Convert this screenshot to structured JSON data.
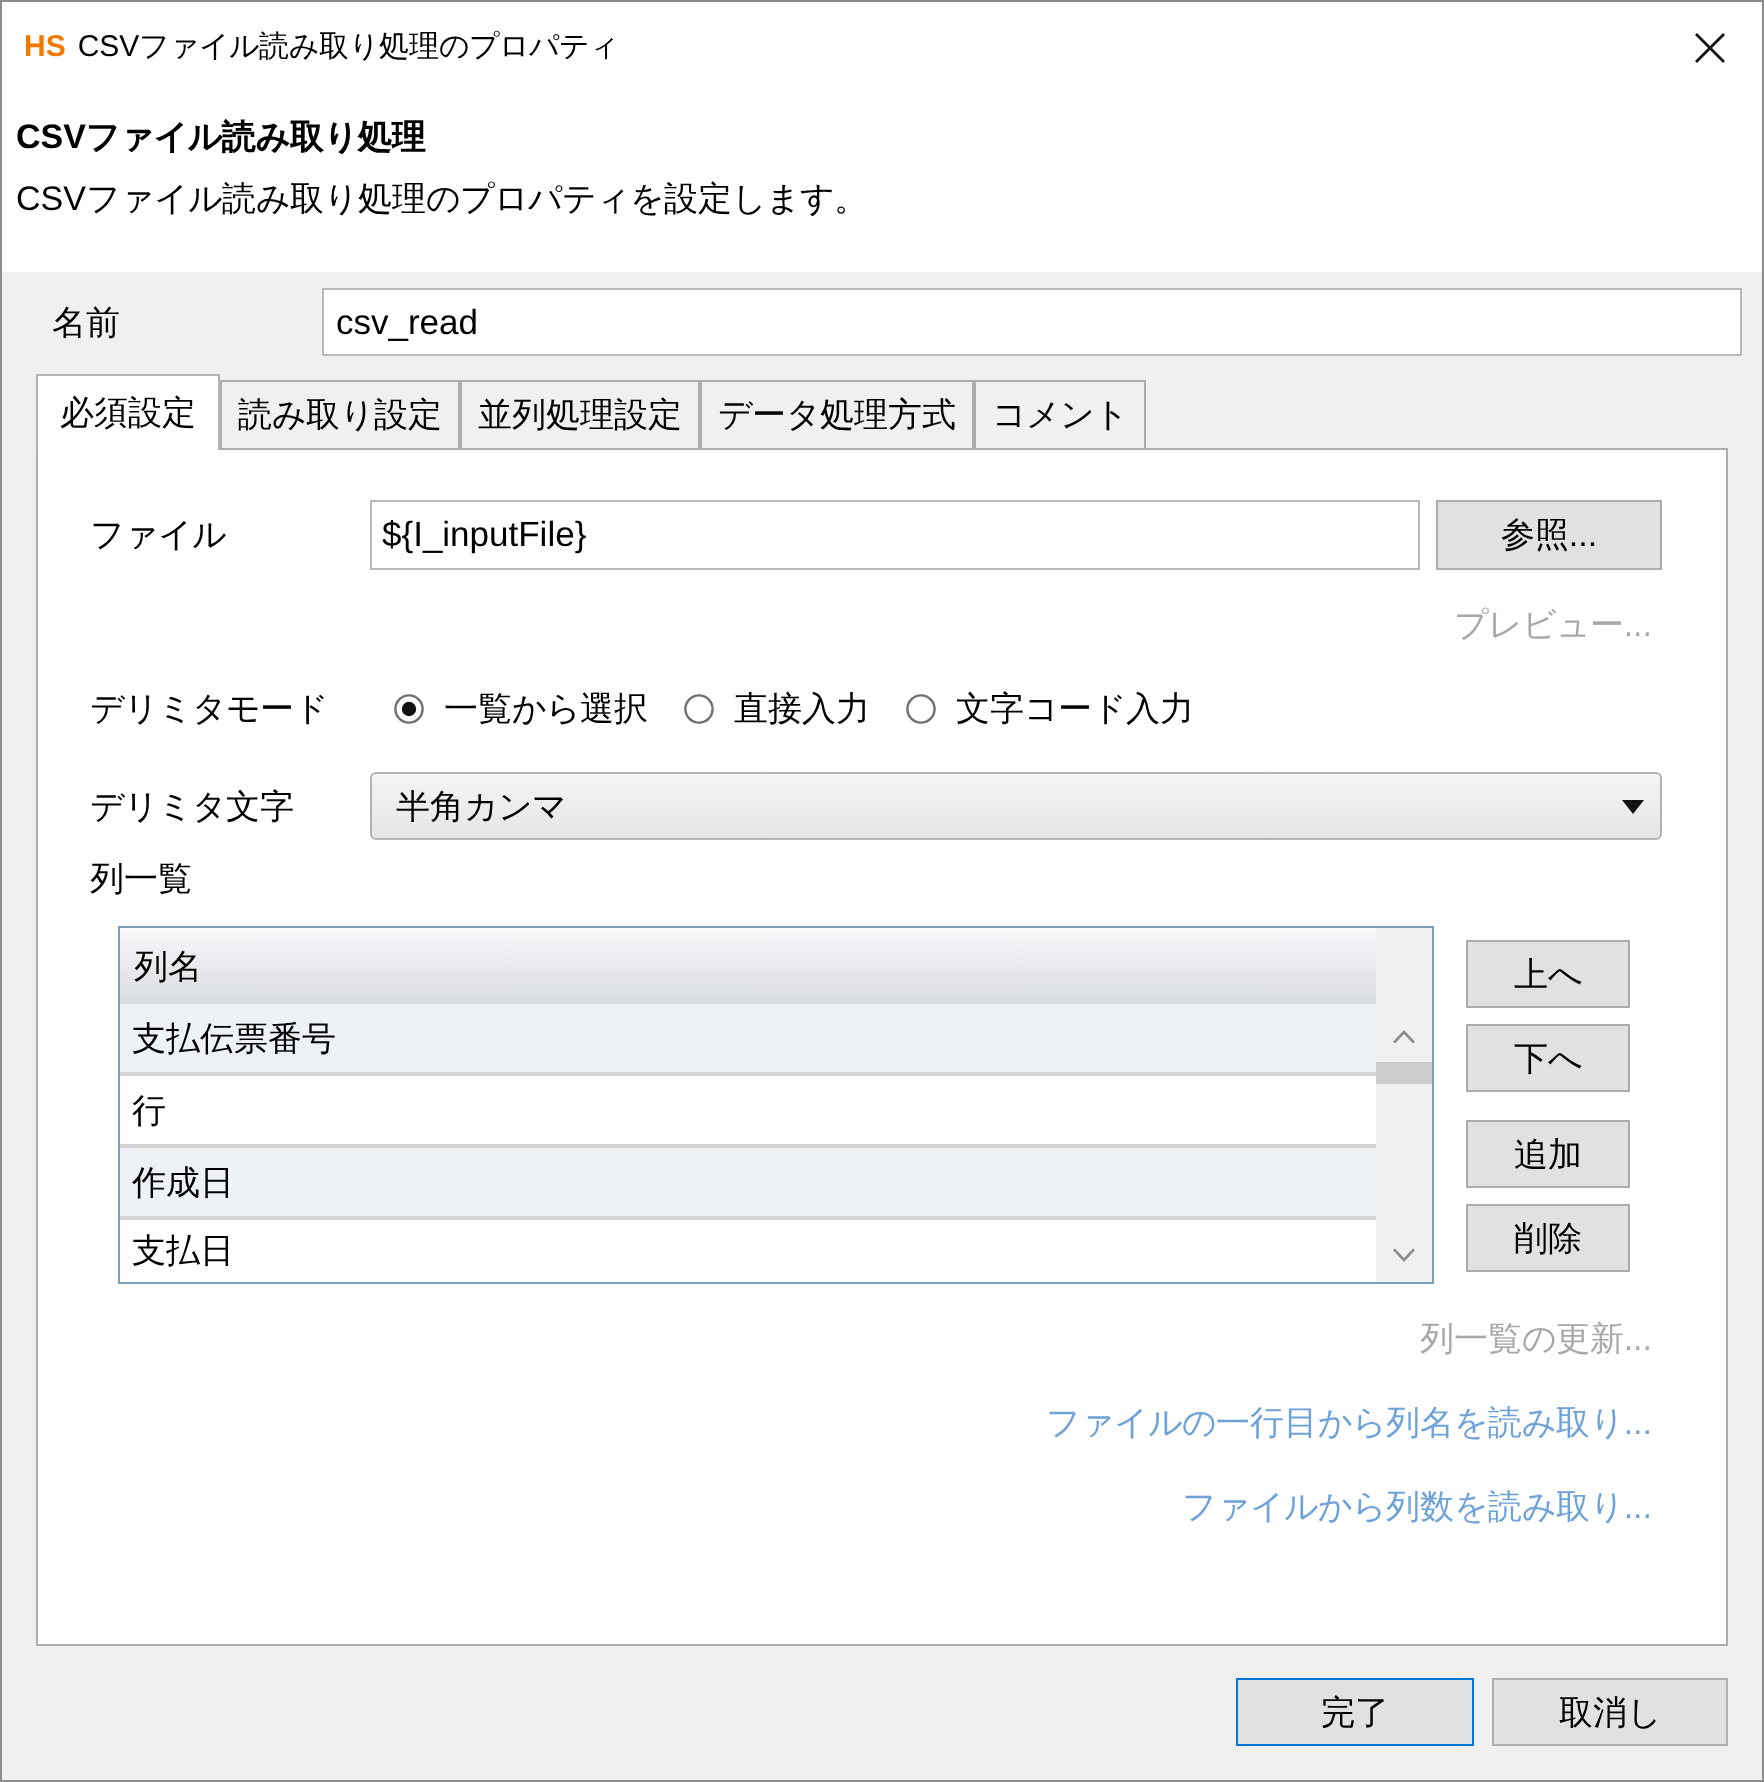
{
  "window": {
    "logo": "HS",
    "title": "CSVファイル読み取り処理のプロパティ"
  },
  "header": {
    "title": "CSVファイル読み取り処理",
    "description": "CSVファイル読み取り処理のプロパティを設定します。"
  },
  "name_field": {
    "label": "名前",
    "value": "csv_read"
  },
  "tabs": [
    {
      "label": "必須設定",
      "selected": true
    },
    {
      "label": "読み取り設定",
      "selected": false
    },
    {
      "label": "並列処理設定",
      "selected": false
    },
    {
      "label": "データ処理方式",
      "selected": false
    },
    {
      "label": "コメント",
      "selected": false
    }
  ],
  "file": {
    "label": "ファイル",
    "value": "${I_inputFile}",
    "browse_button": "参照...",
    "preview_link": {
      "label": "プレビュー...",
      "disabled": true
    }
  },
  "delimiter_mode": {
    "label": "デリミタモード",
    "options": [
      {
        "label": "一覧から選択",
        "selected": true
      },
      {
        "label": "直接入力",
        "selected": false
      },
      {
        "label": "文字コード入力",
        "selected": false
      }
    ]
  },
  "delimiter_char": {
    "label": "デリミタ文字",
    "value": "半角カンマ"
  },
  "column_list": {
    "label": "列一覧",
    "table": {
      "columns": [
        "列名"
      ],
      "rows": [
        [
          "支払伝票番号"
        ],
        [
          "行"
        ],
        [
          "作成日"
        ],
        [
          "支払日"
        ]
      ]
    },
    "move_buttons": [
      "上へ",
      "下へ"
    ],
    "edit_buttons": [
      "追加",
      "削除"
    ]
  },
  "links": [
    {
      "label": "列一覧の更新...",
      "disabled": true
    },
    {
      "label": "ファイルの一行目から列名を読み取り...",
      "disabled": false
    },
    {
      "label": "ファイルから列数を読み取り...",
      "disabled": false
    }
  ],
  "buttons": [
    {
      "label": "完了",
      "default": true
    },
    {
      "label": "取消し",
      "default": false
    }
  ]
}
